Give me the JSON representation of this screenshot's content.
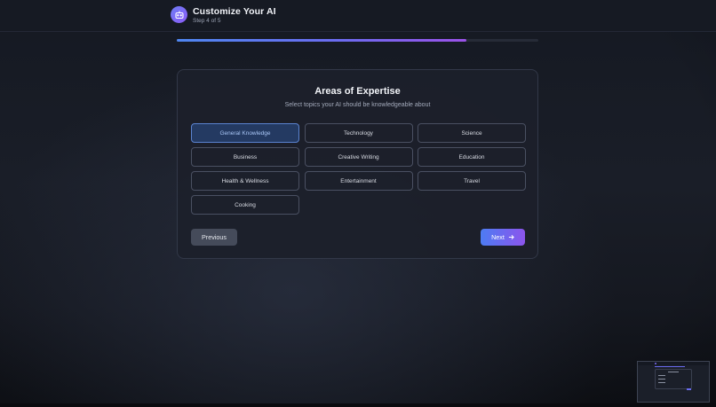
{
  "header": {
    "title": "Customize Your AI",
    "step": "Step 4 of 5",
    "icon": "robot-icon"
  },
  "progress": {
    "current_step": 4,
    "total_steps": 5,
    "fraction": 0.8
  },
  "card": {
    "title": "Areas of Expertise",
    "description": "Select topics your AI should be knowledgeable about",
    "topics": [
      {
        "label": "General Knowledge",
        "selected": true
      },
      {
        "label": "Technology",
        "selected": false
      },
      {
        "label": "Science",
        "selected": false
      },
      {
        "label": "Business",
        "selected": false
      },
      {
        "label": "Creative Writing",
        "selected": false
      },
      {
        "label": "Education",
        "selected": false
      },
      {
        "label": "Health & Wellness",
        "selected": false
      },
      {
        "label": "Entertainment",
        "selected": false
      },
      {
        "label": "Travel",
        "selected": false
      },
      {
        "label": "Cooking",
        "selected": false
      }
    ]
  },
  "actions": {
    "previous_label": "Previous",
    "next_label": "Next",
    "next_icon": "arrow-right-icon"
  },
  "colors": {
    "accent_start": "#4d7cf3",
    "accent_end": "#8c55ec",
    "selected_bg": "#243a62",
    "selected_text": "#a9c6f6"
  }
}
